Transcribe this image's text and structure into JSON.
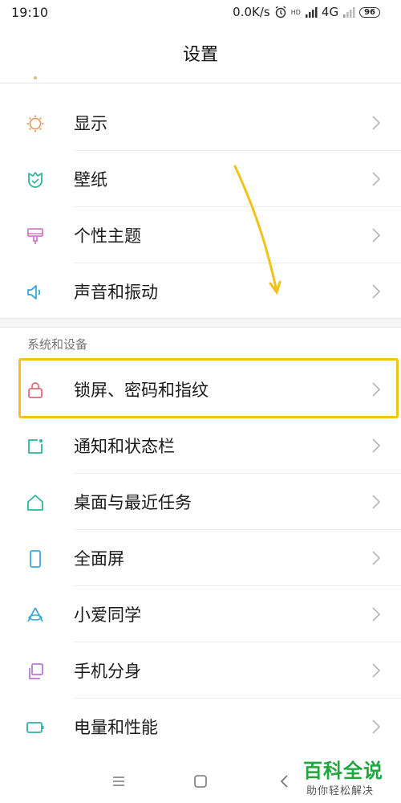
{
  "status_bar": {
    "time": "19:10",
    "speed": "0.0K/s",
    "network": "4G",
    "hd": "HD",
    "battery": "96",
    "icons": [
      "alarm-icon",
      "signal-icon",
      "signal-weak-icon"
    ]
  },
  "header": {
    "title": "设置"
  },
  "section_1": {
    "items": [
      {
        "label": "显示",
        "icon": "sun-icon",
        "color": "#e8a064"
      },
      {
        "label": "壁纸",
        "icon": "wallpaper-icon",
        "color": "#35b59a"
      },
      {
        "label": "个性主题",
        "icon": "theme-brush-icon",
        "color": "#d27bc8"
      },
      {
        "label": "声音和振动",
        "icon": "speaker-icon",
        "color": "#3aa8d8"
      }
    ]
  },
  "section_2": {
    "header": "系统和设备",
    "items": [
      {
        "label": "锁屏、密码和指纹",
        "icon": "lock-icon",
        "color": "#e06a7a"
      },
      {
        "label": "通知和状态栏",
        "icon": "notification-icon",
        "color": "#2bb5a3"
      },
      {
        "label": "桌面与最近任务",
        "icon": "home-icon",
        "color": "#2bb5a3"
      },
      {
        "label": "全面屏",
        "icon": "phone-icon",
        "color": "#3aa8d8"
      },
      {
        "label": "小爱同学",
        "icon": "xiaoai-icon",
        "color": "#3aa8d8"
      },
      {
        "label": "手机分身",
        "icon": "clone-icon",
        "color": "#b879d4"
      },
      {
        "label": "电量和性能",
        "icon": "battery-icon",
        "color": "#2bb5a3"
      }
    ]
  },
  "annotation": {
    "highlight_color": "#f3c21a"
  },
  "watermark": {
    "main": "百科全说",
    "sub": "助你轻松解决",
    "color": "#1ea73f"
  },
  "nav_bar": {
    "icons": [
      "menu-icon",
      "home-square-icon",
      "back-icon"
    ]
  }
}
